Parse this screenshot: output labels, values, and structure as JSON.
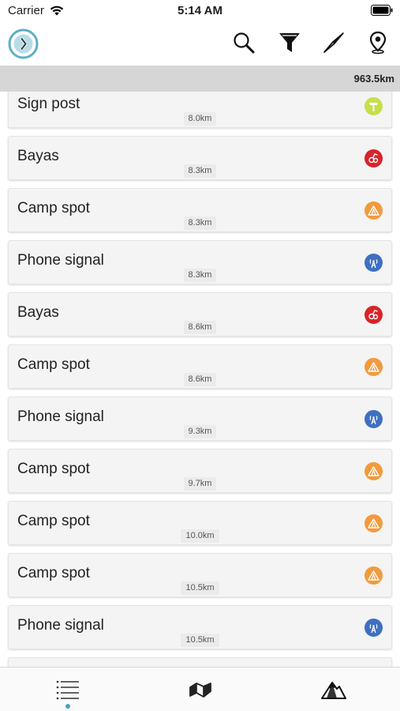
{
  "status_bar": {
    "carrier": "Carrier",
    "time": "5:14 AM"
  },
  "toolbar": {
    "icons": [
      "logo-icon",
      "search-icon",
      "filter-icon",
      "compass-icon",
      "location-pin-icon"
    ]
  },
  "distance_header": {
    "total": "963.5km"
  },
  "poi_list": [
    {
      "name": "Sign post",
      "distance": "8.0km",
      "icon": "signpost-icon",
      "color": "#c6df4a"
    },
    {
      "name": "Bayas",
      "distance": "8.3km",
      "icon": "berries-icon",
      "color": "#d8232a"
    },
    {
      "name": "Camp spot",
      "distance": "8.3km",
      "icon": "tent-icon",
      "color": "#f29a3d"
    },
    {
      "name": "Phone signal",
      "distance": "8.3km",
      "icon": "phone-signal-icon",
      "color": "#3f6fc1"
    },
    {
      "name": "Bayas",
      "distance": "8.6km",
      "icon": "berries-icon",
      "color": "#d8232a"
    },
    {
      "name": "Camp spot",
      "distance": "8.6km",
      "icon": "tent-icon",
      "color": "#f29a3d"
    },
    {
      "name": "Phone signal",
      "distance": "9.3km",
      "icon": "phone-signal-icon",
      "color": "#3f6fc1"
    },
    {
      "name": "Camp spot",
      "distance": "9.7km",
      "icon": "tent-icon",
      "color": "#f29a3d"
    },
    {
      "name": "Camp spot",
      "distance": "10.0km",
      "icon": "tent-icon",
      "color": "#f29a3d"
    },
    {
      "name": "Camp spot",
      "distance": "10.5km",
      "icon": "tent-icon",
      "color": "#f29a3d"
    },
    {
      "name": "Phone signal",
      "distance": "10.5km",
      "icon": "phone-signal-icon",
      "color": "#3f6fc1"
    }
  ],
  "tabbar": {
    "tabs": [
      {
        "icon": "list-icon",
        "active": true
      },
      {
        "icon": "map-icon",
        "active": false
      },
      {
        "icon": "mountain-icon",
        "active": false
      }
    ],
    "accent": "#4aa3b8"
  }
}
